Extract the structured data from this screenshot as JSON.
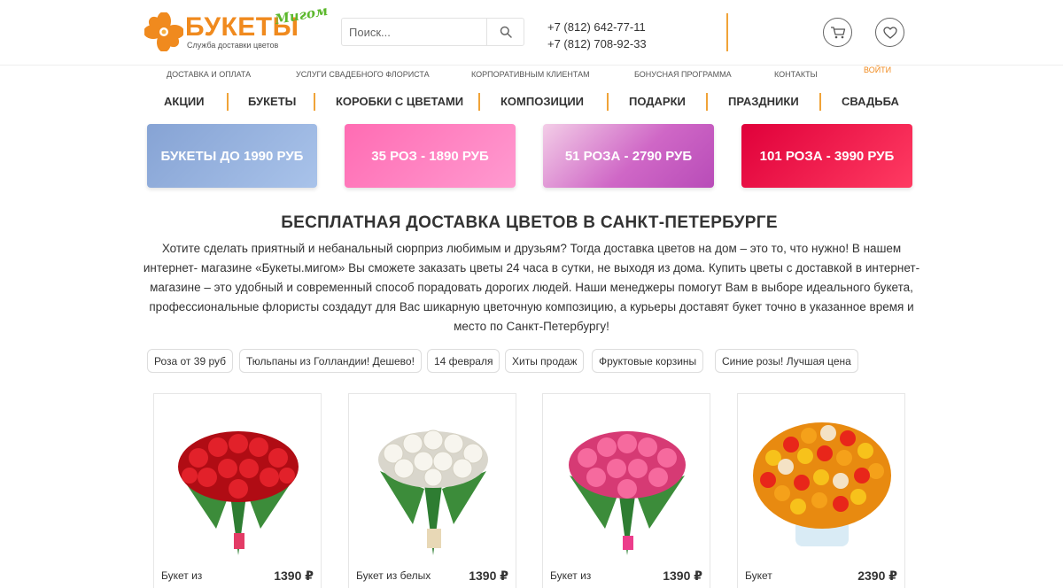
{
  "logo": {
    "text": "БУКЕТЫ",
    "script": "Мигом",
    "tagline": "Служба доставки цветов"
  },
  "search": {
    "placeholder": "Поиск..."
  },
  "phones": [
    "+7 (812) 642-77-11",
    "+7 (812) 708-92-33"
  ],
  "top_nav": [
    "Доставка и оплата",
    "Услуги свадебного флориста",
    "Корпоративным клиентам",
    "Бонусная программа",
    "Контакты"
  ],
  "login_label": "Войти",
  "main_nav": [
    "Акции",
    "Букеты",
    "Коробки с цветами",
    "Композиции",
    "Подарки",
    "Праздники",
    "Свадьба"
  ],
  "promos": [
    "Букеты до 1990 руб",
    "35 роз - 1890 руб",
    "51 роза - 2790 руб",
    "101 роза - 3990 руб"
  ],
  "page_title": "Бесплатная доставка цветов в Санкт-Петербурге",
  "description": "Хотите сделать приятный и небанальный сюрприз любимым и друзьям? Тогда доставка цветов на дом – это то, что нужно! В нашем интернет- магазине «Букеты.мигом» Вы сможете заказать цветы 24 часа в сутки, не выходя из дома. Купить цветы с доставкой в интернет-магазине – это удобный и современный способ порадовать дорогих людей. Наши менеджеры помогут Вам в выборе идеального букета, профессиональные флористы создадут для Вас шикарную цветочную композицию, а курьеры доставят букет точно в указанное время и место по Санкт-Петербургу!",
  "tags": [
    "Роза от 39 руб",
    "Тюльпаны из Голландии! Дешево!",
    "14 февраля",
    "Хиты продаж",
    "Фруктовые корзины",
    "Синие розы! Лучшая цена"
  ],
  "products": [
    {
      "name": "Букет из",
      "price": "1390 ₽",
      "color": "#d8151e"
    },
    {
      "name": "Букет из белых",
      "price": "1390 ₽",
      "color": "#f3f1ea"
    },
    {
      "name": "Букет из",
      "price": "1390 ₽",
      "color": "#f0578f"
    },
    {
      "name": "Букет",
      "price": "2390 ₽",
      "color": "#f5a11a"
    }
  ],
  "colors": {
    "brand_orange": "#f08a1e",
    "brand_green": "#5cb82d",
    "separator": "#f0a338"
  },
  "icons": {
    "cart": "cart-icon",
    "wishlist": "heart-icon",
    "search": "search-icon"
  }
}
